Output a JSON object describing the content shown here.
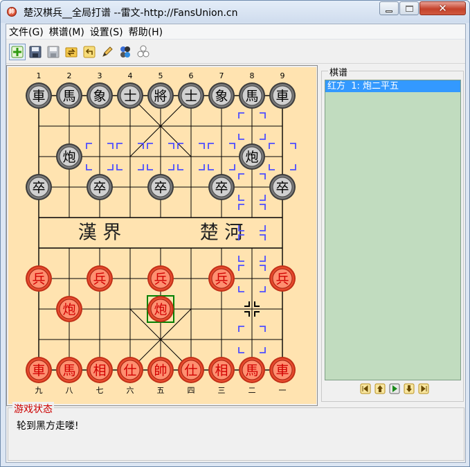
{
  "window": {
    "title": "楚汉棋兵__全局打谱 --雷文-http://FansUnion.cn",
    "icon": "xiangqi-app-icon",
    "controls": [
      "minimize",
      "maximize",
      "close"
    ]
  },
  "menu": [
    {
      "label": "文件(G)"
    },
    {
      "label": "棋谱(M)"
    },
    {
      "label": "设置(S)"
    },
    {
      "label": "帮助(H)"
    }
  ],
  "toolbar": [
    {
      "name": "new-game",
      "icon": "green-plus-icon"
    },
    {
      "name": "save",
      "icon": "floppy-icon"
    },
    {
      "name": "save-as",
      "icon": "floppy-gray-icon"
    },
    {
      "name": "open",
      "icon": "folder-arrows-icon"
    },
    {
      "name": "undo",
      "icon": "undo-arrow-icon"
    },
    {
      "name": "edit",
      "icon": "pencil-icon"
    },
    {
      "name": "red-first",
      "icon": "colored-circles-icon"
    },
    {
      "name": "black-first",
      "icon": "gray-circles-icon"
    }
  ],
  "board": {
    "top_numbers": [
      "1",
      "2",
      "3",
      "4",
      "5",
      "6",
      "7",
      "8",
      "9"
    ],
    "bottom_numbers": [
      "九",
      "八",
      "七",
      "六",
      "五",
      "四",
      "三",
      "二",
      "一"
    ],
    "river_left": "漢 界",
    "river_right": "楚 河",
    "colors": {
      "background": "#ffe3b0",
      "red_piece": "#e84a2e",
      "black_piece": "#7a7a7a",
      "hint": "#4d4dff",
      "selected": "#008000"
    },
    "black_pieces": [
      {
        "col": 0,
        "row": 0,
        "char": "車"
      },
      {
        "col": 1,
        "row": 0,
        "char": "馬"
      },
      {
        "col": 2,
        "row": 0,
        "char": "象"
      },
      {
        "col": 3,
        "row": 0,
        "char": "士"
      },
      {
        "col": 4,
        "row": 0,
        "char": "將"
      },
      {
        "col": 5,
        "row": 0,
        "char": "士"
      },
      {
        "col": 6,
        "row": 0,
        "char": "象"
      },
      {
        "col": 7,
        "row": 0,
        "char": "馬"
      },
      {
        "col": 8,
        "row": 0,
        "char": "車"
      },
      {
        "col": 1,
        "row": 2,
        "char": "炮"
      },
      {
        "col": 7,
        "row": 2,
        "char": "炮"
      },
      {
        "col": 0,
        "row": 3,
        "char": "卒"
      },
      {
        "col": 2,
        "row": 3,
        "char": "卒"
      },
      {
        "col": 4,
        "row": 3,
        "char": "卒"
      },
      {
        "col": 6,
        "row": 3,
        "char": "卒"
      },
      {
        "col": 8,
        "row": 3,
        "char": "卒"
      }
    ],
    "red_pieces": [
      {
        "col": 0,
        "row": 6,
        "char": "兵"
      },
      {
        "col": 2,
        "row": 6,
        "char": "兵"
      },
      {
        "col": 4,
        "row": 6,
        "char": "兵"
      },
      {
        "col": 6,
        "row": 6,
        "char": "兵"
      },
      {
        "col": 8,
        "row": 6,
        "char": "兵"
      },
      {
        "col": 1,
        "row": 7,
        "char": "炮"
      },
      {
        "col": 4,
        "row": 7,
        "char": "炮",
        "selected": true
      },
      {
        "col": 0,
        "row": 9,
        "char": "車"
      },
      {
        "col": 1,
        "row": 9,
        "char": "馬"
      },
      {
        "col": 2,
        "row": 9,
        "char": "相"
      },
      {
        "col": 3,
        "row": 9,
        "char": "仕"
      },
      {
        "col": 4,
        "row": 9,
        "char": "帥"
      },
      {
        "col": 5,
        "row": 9,
        "char": "仕"
      },
      {
        "col": 6,
        "row": 9,
        "char": "相"
      },
      {
        "col": 7,
        "row": 9,
        "char": "馬"
      },
      {
        "col": 8,
        "row": 9,
        "char": "車"
      }
    ],
    "hint_marks": [
      {
        "col": 7,
        "row": 1
      },
      {
        "col": 7,
        "row": 3
      },
      {
        "col": 7,
        "row": 4
      },
      {
        "col": 7,
        "row": 5
      },
      {
        "col": 7,
        "row": 6
      },
      {
        "col": 7,
        "row": 8
      },
      {
        "col": 2,
        "row": 2
      },
      {
        "col": 3,
        "row": 2
      },
      {
        "col": 4,
        "row": 2
      },
      {
        "col": 5,
        "row": 2
      },
      {
        "col": 6,
        "row": 2
      },
      {
        "col": 8,
        "row": 2
      }
    ],
    "cursor": {
      "col": 7,
      "row": 7
    }
  },
  "record": {
    "title": "棋谱",
    "moves": [
      "红方  1: 炮二平五"
    ],
    "nav": [
      {
        "name": "first-move",
        "icon": "first-move-icon"
      },
      {
        "name": "prev-move",
        "icon": "prev-move-icon"
      },
      {
        "name": "play",
        "icon": "play-icon"
      },
      {
        "name": "next-move",
        "icon": "next-move-icon"
      },
      {
        "name": "last-move",
        "icon": "last-move-icon"
      }
    ]
  },
  "status": {
    "title": "游戏状态",
    "text": "轮到黑方走喽!"
  }
}
